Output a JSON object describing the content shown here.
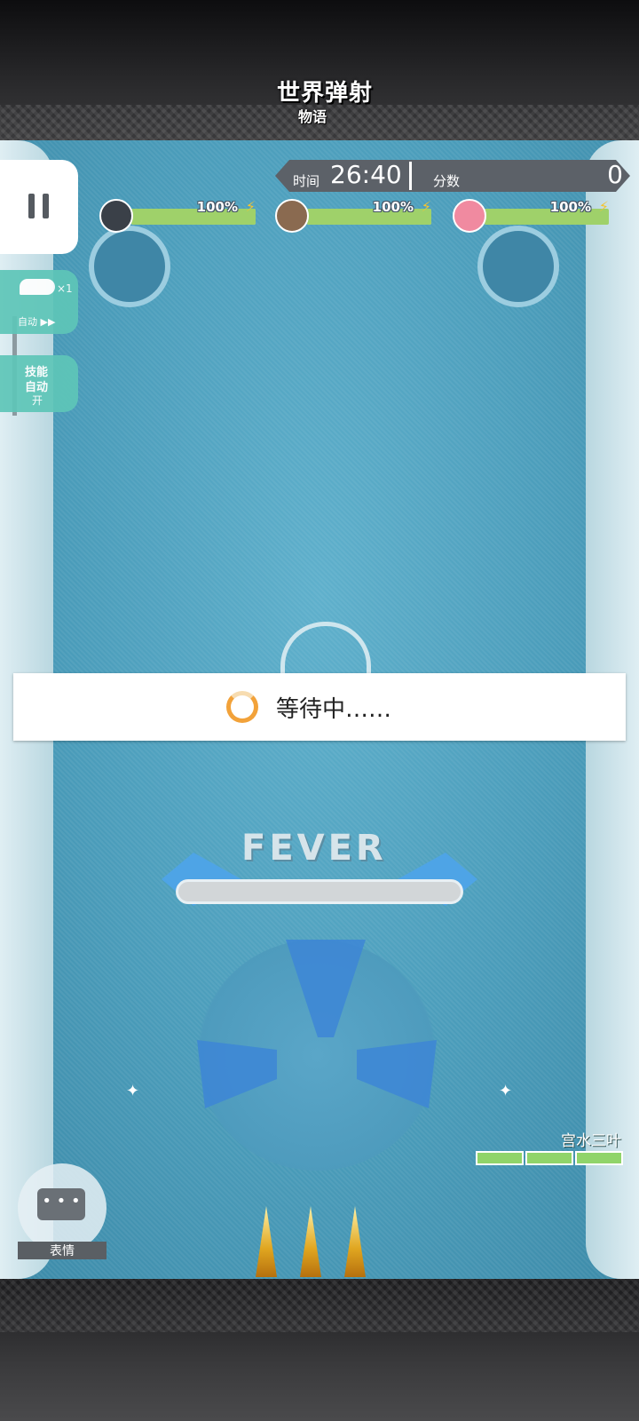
{
  "game": {
    "logo_title": "世界弹射",
    "logo_sub": "物语"
  },
  "hud": {
    "time_label": "时间",
    "time_value": "26:40",
    "score_label": "分数",
    "score_value": "0"
  },
  "party": [
    {
      "hp_text": "100%",
      "hp_fraction": 1.0,
      "avatar_color": "#3a4048"
    },
    {
      "hp_text": "100%",
      "hp_fraction": 1.0,
      "avatar_color": "#8a6a50"
    },
    {
      "hp_text": "100%",
      "hp_fraction": 1.0,
      "avatar_color": "#f08aa0"
    }
  ],
  "left_controls": {
    "pause_icon": "pause-icon",
    "auto_count": "×1",
    "auto_label": "自动 ▶▶",
    "skill_line1": "技能",
    "skill_line2": "自动",
    "skill_line3": "开"
  },
  "waiting": {
    "text": "等待中……",
    "spinner_color": "#f2a23a"
  },
  "fever": {
    "label": "FEVER",
    "fraction": 0.0
  },
  "player": {
    "name": "宫水三叶",
    "hp_segments": 3
  },
  "emote": {
    "icon": "chat-bubble-icon",
    "bubble_text": "• • •",
    "label": "表情"
  },
  "colors": {
    "hp_green": "#9fd16a",
    "fever_blue": "#4ea4e6",
    "side_button": "#5ec6b8"
  }
}
